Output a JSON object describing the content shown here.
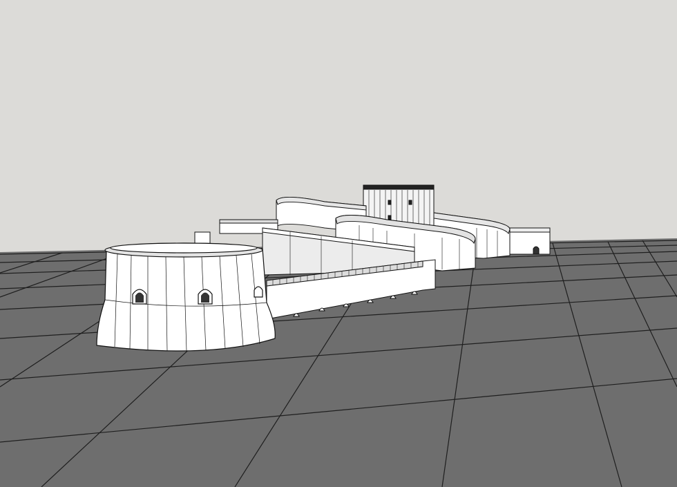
{
  "scene": {
    "description_visible_text": "",
    "colors": {
      "sky": "#dcdbd8",
      "ground": "#6e6e6e",
      "grid_line": "#1e1e1e",
      "model_face": "#ffffff",
      "model_shade": "#e8e8e8",
      "model_dark": "#c9c9c9",
      "edge": "#111111"
    }
  }
}
